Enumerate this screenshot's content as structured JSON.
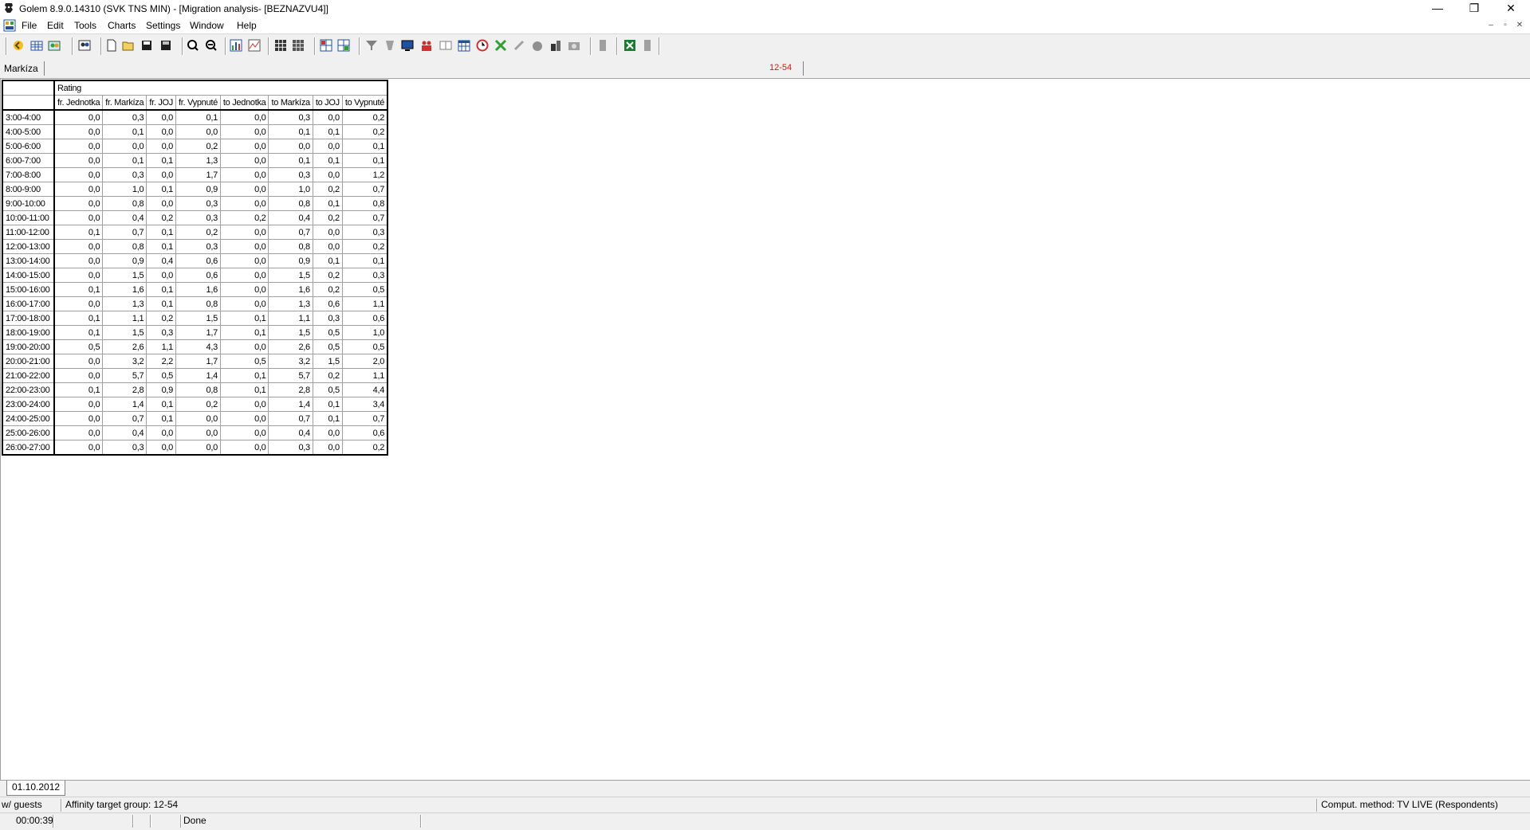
{
  "window": {
    "title": "Golem 8.9.0.14310 (SVK TNS MIN) - [Migration analysis- [BEZNAZVU4]]",
    "minimize": "—",
    "restore": "❐",
    "close": "✕"
  },
  "menu": {
    "items": [
      "File",
      "Edit",
      "Tools",
      "Charts",
      "Settings",
      "Window",
      "Help"
    ],
    "mdi_minimize": "–",
    "mdi_restore": "▫",
    "mdi_close": "✕"
  },
  "toolbar": {
    "icons": [
      "arrow-icon",
      "table-icon",
      "people-icon",
      "filter-people-icon",
      "new-icon",
      "open-icon",
      "save-icon",
      "save-as-icon",
      "zoom-in-icon",
      "zoom-out-icon",
      "bar-chart-icon",
      "line-chart-icon",
      "grid-icon",
      "grid2-icon",
      "grid3-icon",
      "grid4-icon",
      "funnel-icon",
      "funnel2-icon",
      "monitor-icon",
      "people-red-icon",
      "book-icon",
      "calendar-icon",
      "clock-icon",
      "x-icon",
      "link-icon",
      "apple-icon",
      "tools-icon",
      "camera-icon",
      "disabled-icon",
      "excel-icon",
      "disabled2-icon"
    ]
  },
  "strip": {
    "label": "Markíza",
    "target": "12-54"
  },
  "table": {
    "group_header": "Rating",
    "columns": [
      "fr. Jednotka",
      "fr. Markíza",
      "fr. JOJ",
      "fr. Vypnuté",
      "to Jednotka",
      "to Markíza",
      "to JOJ",
      "to Vypnuté"
    ],
    "rows": [
      {
        "label": "3:00-4:00",
        "values": [
          "0,0",
          "0,3",
          "0,0",
          "0,1",
          "0,0",
          "0,3",
          "0,0",
          "0,2"
        ]
      },
      {
        "label": "4:00-5:00",
        "values": [
          "0,0",
          "0,1",
          "0,0",
          "0,0",
          "0,0",
          "0,1",
          "0,1",
          "0,2"
        ]
      },
      {
        "label": "5:00-6:00",
        "values": [
          "0,0",
          "0,0",
          "0,0",
          "0,2",
          "0,0",
          "0,0",
          "0,0",
          "0,1"
        ]
      },
      {
        "label": "6:00-7:00",
        "values": [
          "0,0",
          "0,1",
          "0,1",
          "1,3",
          "0,0",
          "0,1",
          "0,1",
          "0,1"
        ]
      },
      {
        "label": "7:00-8:00",
        "values": [
          "0,0",
          "0,3",
          "0,0",
          "1,7",
          "0,0",
          "0,3",
          "0,0",
          "1,2"
        ]
      },
      {
        "label": "8:00-9:00",
        "values": [
          "0,0",
          "1,0",
          "0,1",
          "0,9",
          "0,0",
          "1,0",
          "0,2",
          "0,7"
        ]
      },
      {
        "label": "9:00-10:00",
        "values": [
          "0,0",
          "0,8",
          "0,0",
          "0,3",
          "0,0",
          "0,8",
          "0,1",
          "0,8"
        ]
      },
      {
        "label": "10:00-11:00",
        "values": [
          "0,0",
          "0,4",
          "0,2",
          "0,3",
          "0,2",
          "0,4",
          "0,2",
          "0,7"
        ]
      },
      {
        "label": "11:00-12:00",
        "values": [
          "0,1",
          "0,7",
          "0,1",
          "0,2",
          "0,0",
          "0,7",
          "0,0",
          "0,3"
        ]
      },
      {
        "label": "12:00-13:00",
        "values": [
          "0,0",
          "0,8",
          "0,1",
          "0,3",
          "0,0",
          "0,8",
          "0,0",
          "0,2"
        ]
      },
      {
        "label": "13:00-14:00",
        "values": [
          "0,0",
          "0,9",
          "0,4",
          "0,6",
          "0,0",
          "0,9",
          "0,1",
          "0,1"
        ]
      },
      {
        "label": "14:00-15:00",
        "values": [
          "0,0",
          "1,5",
          "0,0",
          "0,6",
          "0,0",
          "1,5",
          "0,2",
          "0,3"
        ]
      },
      {
        "label": "15:00-16:00",
        "values": [
          "0,1",
          "1,6",
          "0,1",
          "1,6",
          "0,0",
          "1,6",
          "0,2",
          "0,5"
        ]
      },
      {
        "label": "16:00-17:00",
        "values": [
          "0,0",
          "1,3",
          "0,1",
          "0,8",
          "0,0",
          "1,3",
          "0,6",
          "1,1"
        ]
      },
      {
        "label": "17:00-18:00",
        "values": [
          "0,1",
          "1,1",
          "0,2",
          "1,5",
          "0,1",
          "1,1",
          "0,3",
          "0,6"
        ]
      },
      {
        "label": "18:00-19:00",
        "values": [
          "0,1",
          "1,5",
          "0,3",
          "1,7",
          "0,1",
          "1,5",
          "0,5",
          "1,0"
        ]
      },
      {
        "label": "19:00-20:00",
        "values": [
          "0,5",
          "2,6",
          "1,1",
          "4,3",
          "0,0",
          "2,6",
          "0,5",
          "0,5"
        ]
      },
      {
        "label": "20:00-21:00",
        "values": [
          "0,0",
          "3,2",
          "2,2",
          "1,7",
          "0,5",
          "3,2",
          "1,5",
          "2,0"
        ]
      },
      {
        "label": "21:00-22:00",
        "values": [
          "0,0",
          "5,7",
          "0,5",
          "1,4",
          "0,1",
          "5,7",
          "0,2",
          "1,1"
        ]
      },
      {
        "label": "22:00-23:00",
        "values": [
          "0,1",
          "2,8",
          "0,9",
          "0,8",
          "0,1",
          "2,8",
          "0,5",
          "4,4"
        ]
      },
      {
        "label": "23:00-24:00",
        "values": [
          "0,0",
          "1,4",
          "0,1",
          "0,2",
          "0,0",
          "1,4",
          "0,1",
          "3,4"
        ]
      },
      {
        "label": "24:00-25:00",
        "values": [
          "0,0",
          "0,7",
          "0,1",
          "0,0",
          "0,0",
          "0,7",
          "0,1",
          "0,7"
        ]
      },
      {
        "label": "25:00-26:00",
        "values": [
          "0,0",
          "0,4",
          "0,0",
          "0,0",
          "0,0",
          "0,4",
          "0,0",
          "0,6"
        ]
      },
      {
        "label": "26:00-27:00",
        "values": [
          "0,0",
          "0,3",
          "0,0",
          "0,0",
          "0,0",
          "0,3",
          "0,0",
          "0,2"
        ]
      }
    ]
  },
  "tabs": {
    "date": "01.10.2012"
  },
  "status": {
    "guests": "w/ guests",
    "affinity": "Affinity target group: 12-54",
    "method": "Comput. method: TV LIVE (Respondents)",
    "time": "00:00:39",
    "state": "Done"
  }
}
